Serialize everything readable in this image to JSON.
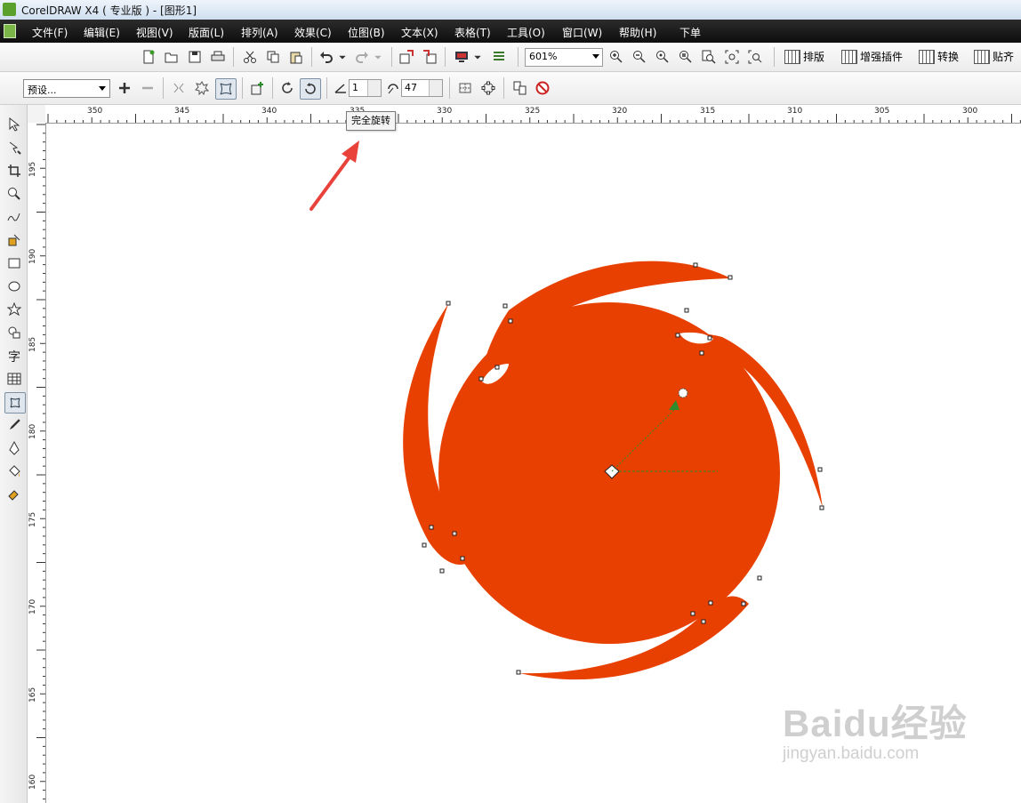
{
  "window": {
    "title": "CorelDRAW X4 ( 专业版 ) - [图形1]"
  },
  "menu": [
    "文件(F)",
    "编辑(E)",
    "视图(V)",
    "版面(L)",
    "排列(A)",
    "效果(C)",
    "位图(B)",
    "文本(X)",
    "表格(T)",
    "工具(O)",
    "窗口(W)",
    "帮助(H)",
    "下单"
  ],
  "toolbar": {
    "zoom_value": "601%",
    "buttons": [
      "排版",
      "增强插件",
      "转换",
      "贴齐"
    ]
  },
  "property_bar": {
    "preset_value": "预设...",
    "angle_value": "1",
    "rotation_value": "47"
  },
  "tooltip": {
    "text": "完全旋转"
  },
  "rulers": {
    "horizontal": [
      "350",
      "345",
      "340",
      "335",
      "330",
      "325",
      "320",
      "315",
      "310",
      "305",
      "300"
    ],
    "vertical": [
      "195",
      "190",
      "185",
      "180",
      "175",
      "170",
      "165",
      "160"
    ]
  },
  "shape": {
    "fill_color": "#E84000"
  },
  "arrow": {
    "color": "#E8423A"
  },
  "watermark": {
    "brand": "Baidu经验",
    "url": "jingyan.baidu.com"
  }
}
